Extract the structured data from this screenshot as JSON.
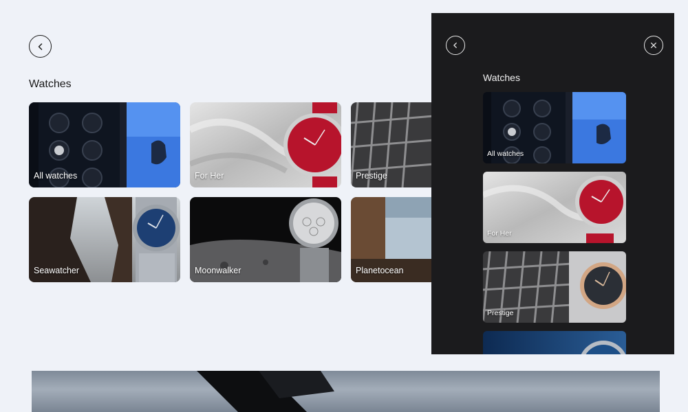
{
  "page": {
    "section_title": "Watches",
    "back_icon": "chevron-left-icon"
  },
  "grid": {
    "cards": [
      {
        "label": "All watches"
      },
      {
        "label": "For Her"
      },
      {
        "label": "Prestige"
      },
      {
        "label": "Seawatcher"
      },
      {
        "label": "Moonwalker"
      },
      {
        "label": "Planetocean"
      }
    ]
  },
  "panel": {
    "title": "Watches",
    "back_icon": "chevron-left-icon",
    "close_icon": "close-icon",
    "cards": [
      {
        "label": "All watches"
      },
      {
        "label": "For Her"
      },
      {
        "label": "Prestige"
      }
    ]
  },
  "colors": {
    "page_bg": "#eff2f8",
    "panel_bg": "#1b1b1d",
    "watch_red": "#b7142c",
    "watch_blue": "#1d3f73"
  }
}
